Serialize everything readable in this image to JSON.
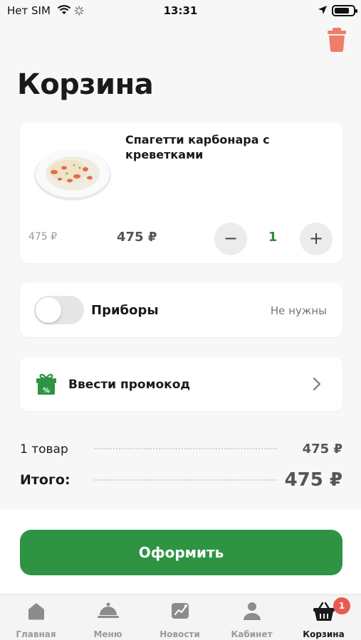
{
  "status_bar": {
    "carrier": "Нет SIM",
    "time": "13:31"
  },
  "header": {
    "title": "Корзина"
  },
  "cart_item": {
    "name": "Спагетти карбонара с креветками",
    "old_price": "475 ₽",
    "price": "475 ₽",
    "quantity": "1",
    "minus_label": "−",
    "plus_label": "+"
  },
  "cutlery": {
    "label": "Приборы",
    "value": "Не нужны",
    "enabled": false
  },
  "promo": {
    "label": "Ввести промокод"
  },
  "summary": {
    "items_label": "1 товар",
    "items_value": "475 ₽",
    "total_label": "Итого:",
    "total_value": "475 ₽"
  },
  "checkout": {
    "label": "Оформить"
  },
  "tabbar": {
    "tabs": [
      {
        "label": "Главная",
        "icon": "home-icon"
      },
      {
        "label": "Меню",
        "icon": "cloche-icon"
      },
      {
        "label": "Новости",
        "icon": "news-icon"
      },
      {
        "label": "Кабинет",
        "icon": "user-icon"
      },
      {
        "label": "Корзина",
        "icon": "basket-icon"
      }
    ],
    "cart_badge": "1"
  },
  "colors": {
    "accent_green": "#2e9443",
    "trash_red": "#f07c69",
    "badge_red": "#e85a4f"
  }
}
